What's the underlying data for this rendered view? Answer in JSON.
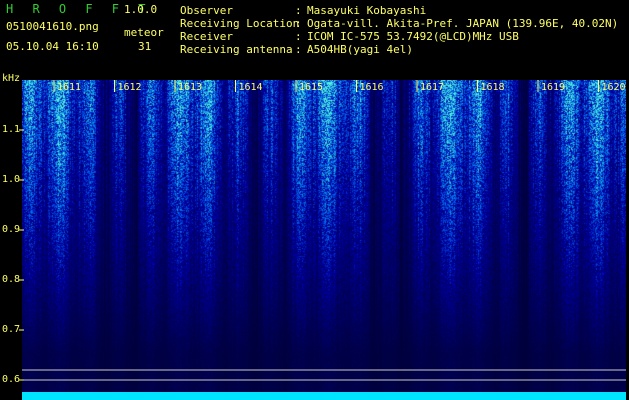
{
  "app": {
    "name": "H R O F F T",
    "version": "1.0.0"
  },
  "file": {
    "name": "0510041610.png",
    "datetime": "05.10.04 16:10"
  },
  "meteor": {
    "label": "meteor",
    "count": "31"
  },
  "info": [
    {
      "key": "Observer",
      "value": "Masayuki Kobayashi"
    },
    {
      "key": "Receiving Location",
      "value": "Ogata-vill. Akita-Pref. JAPAN (139.96E, 40.02N)"
    },
    {
      "key": "Receiver",
      "value": "ICOM IC-575 53.7492(@LCD)MHz USB"
    },
    {
      "key": "Receiving antenna",
      "value": "A504HB(yagi 4el)"
    }
  ],
  "axis": {
    "y_unit": "kHz",
    "y_ticks": [
      "1.1",
      "1.0",
      "0.9",
      "0.8",
      "0.7",
      "0.6"
    ],
    "x_ticks": [
      "1611",
      "1612",
      "1613",
      "1614",
      "1615",
      "1616",
      "1617",
      "1618",
      "1619",
      "1620"
    ]
  },
  "colors": {
    "text": "#ffff66",
    "title": "#33cc33",
    "ref_line": "#cccccc",
    "baseline": "#00e5ff"
  }
}
